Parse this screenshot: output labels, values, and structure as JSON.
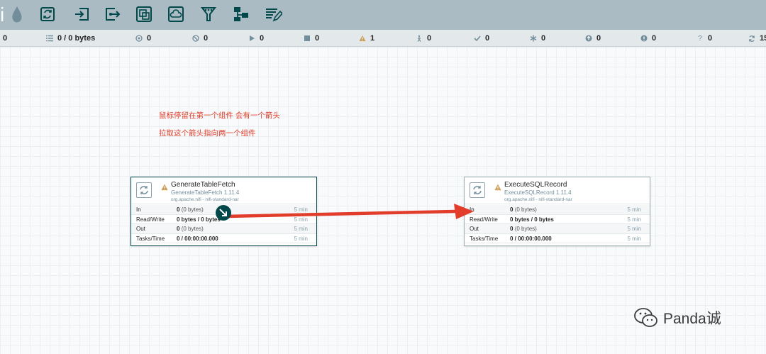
{
  "toolbar": {
    "logo_letter": "i",
    "tools": [
      {
        "icon": "processor-icon"
      },
      {
        "icon": "input-port-icon"
      },
      {
        "icon": "output-port-icon"
      },
      {
        "icon": "process-group-icon"
      },
      {
        "icon": "remote-process-group-icon"
      },
      {
        "icon": "funnel-icon"
      },
      {
        "icon": "template-icon"
      },
      {
        "icon": "label-icon"
      }
    ]
  },
  "status": {
    "active_threads": "0",
    "queued": "0 / 0 bytes",
    "transmitting": "0",
    "not_transmitting": "0",
    "running": "0",
    "stopped": "0",
    "invalid": "1",
    "disabled": "0",
    "up_to_date": "0",
    "locally_modified": "0",
    "stale": "0",
    "locally_modified_stale": "0",
    "sync_failure": "0",
    "refresh": "15"
  },
  "notes": {
    "line1": "鼠标停留在第一个组件 会有一个箭头",
    "line2": "拉取这个箭头指向两一个组件"
  },
  "processors": [
    {
      "name": "GenerateTableFetch",
      "type": "GenerateTableFetch 1.11.4",
      "bundle": "org.apache.nifi - nifi-standard-nar",
      "rows": [
        {
          "label": "In",
          "value": "0",
          "detail": "(0 bytes)",
          "time": "5 min"
        },
        {
          "label": "Read/Write",
          "value": "0 bytes / 0 bytes",
          "detail": "",
          "time": "5 min"
        },
        {
          "label": "Out",
          "value": "0",
          "detail": "(0 bytes)",
          "time": "5 min"
        },
        {
          "label": "Tasks/Time",
          "value": "0 / 00:00:00.000",
          "detail": "",
          "time": "5 min"
        }
      ]
    },
    {
      "name": "ExecuteSQLRecord",
      "type": "ExecuteSQLRecord 1.11.4",
      "bundle": "org.apache.nifi - nifi-standard-nar",
      "rows": [
        {
          "label": "In",
          "value": "0",
          "detail": "(0 bytes)",
          "time": "5 min"
        },
        {
          "label": "Read/Write",
          "value": "0 bytes / 0 bytes",
          "detail": "",
          "time": "5 min"
        },
        {
          "label": "Out",
          "value": "0",
          "detail": "(0 bytes)",
          "time": "5 min"
        },
        {
          "label": "Tasks/Time",
          "value": "0 / 00:00:00.000",
          "detail": "",
          "time": "5 min"
        }
      ]
    }
  ],
  "watermark": {
    "text": "Panda诚"
  },
  "colors": {
    "toolbar": "#aabbc3",
    "accent": "#004849",
    "arrow": "#e23c2a",
    "warning": "#cf9f5d"
  }
}
